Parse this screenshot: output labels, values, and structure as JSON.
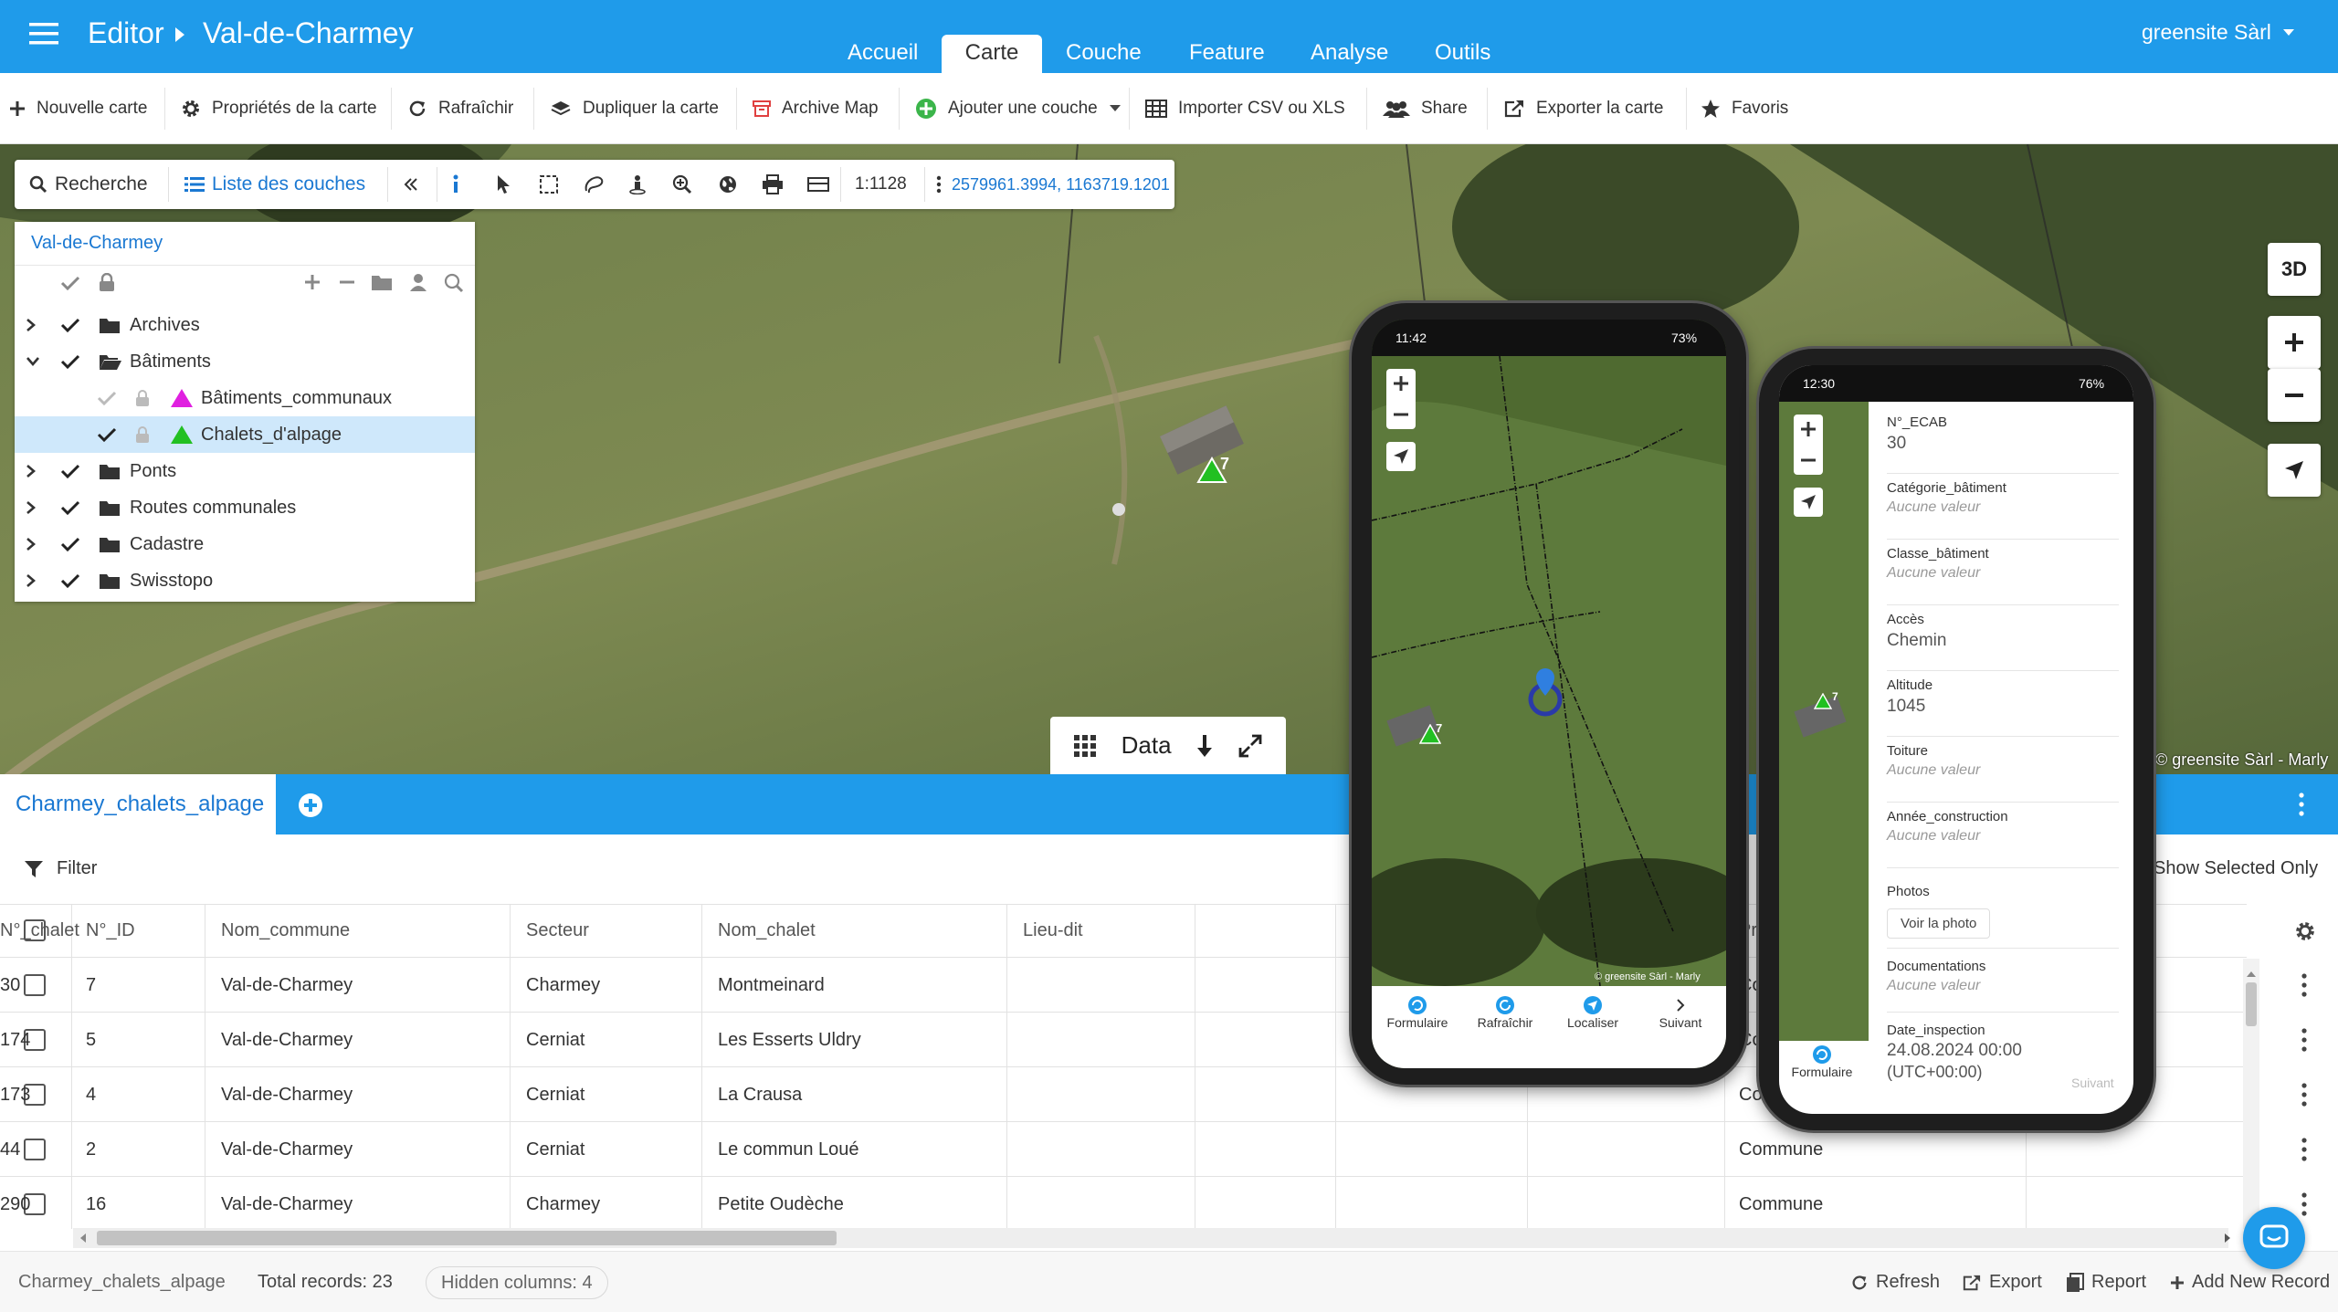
{
  "header": {
    "app": "Editor",
    "map_name": "Val-de-Charmey",
    "user": "greensite Sàrl",
    "tabs": [
      "Accueil",
      "Carte",
      "Couche",
      "Feature",
      "Analyse",
      "Outils"
    ],
    "active_tab": "Carte"
  },
  "toolbar": {
    "new_map": "Nouvelle carte",
    "map_props": "Propriétés de la carte",
    "refresh": "Rafraîchir",
    "duplicate": "Dupliquer la carte",
    "archive": "Archive Map",
    "add_layer": "Ajouter une couche",
    "import": "Importer CSV ou XLS",
    "share": "Share",
    "export": "Exporter la carte",
    "favorites": "Favoris"
  },
  "maptools": {
    "search": "Recherche",
    "layer_list": "Liste des couches",
    "scale": "1:1128",
    "coords": "2579961.3994, 1163719.1201"
  },
  "layers": {
    "root": "Val-de-Charmey",
    "items": [
      {
        "label": "Archives",
        "type": "folder",
        "expanded": false
      },
      {
        "label": "Bâtiments",
        "type": "folder",
        "expanded": true
      },
      {
        "label": "Bâtiments_communaux",
        "type": "layer",
        "color": "#e020e0"
      },
      {
        "label": "Chalets_d'alpage",
        "type": "layer",
        "color": "#22c022"
      },
      {
        "label": "Ponts",
        "type": "folder",
        "expanded": false
      },
      {
        "label": "Routes communales",
        "type": "folder",
        "expanded": false
      },
      {
        "label": "Cadastre",
        "type": "folder",
        "expanded": false
      },
      {
        "label": "Swisstopo",
        "type": "folder",
        "expanded": false
      }
    ]
  },
  "map": {
    "btn_3d": "3D",
    "copyright": "© greensite Sàrl - Marly",
    "marker_label": "7",
    "data_label": "Data"
  },
  "table": {
    "tab_name": "Charmey_chalets_alpage",
    "filter": "Filter",
    "show_selected": "Show Selected Only",
    "columns": [
      "N°_ID",
      "Nom_commune",
      "Secteur",
      "Nom_chalet",
      "Lieu-dit",
      "N°_chalet"
    ],
    "partial_col": "Pr",
    "rows": [
      {
        "id": "7",
        "commune": "Val-de-Charmey",
        "secteur": "Charmey",
        "chalet": "Montmeinard",
        "lieu": "",
        "num": "30",
        "prop": "Co"
      },
      {
        "id": "5",
        "commune": "Val-de-Charmey",
        "secteur": "Cerniat",
        "chalet": "Les Esserts Uldry",
        "lieu": "",
        "num": "174",
        "prop": "Co"
      },
      {
        "id": "4",
        "commune": "Val-de-Charmey",
        "secteur": "Cerniat",
        "chalet": "La Crausa",
        "lieu": "",
        "num": "173",
        "prop": "Co"
      },
      {
        "id": "2",
        "commune": "Val-de-Charmey",
        "secteur": "Cerniat",
        "chalet": "Le commun Loué",
        "lieu": "",
        "num": "44",
        "prop": "Commune"
      },
      {
        "id": "16",
        "commune": "Val-de-Charmey",
        "secteur": "Charmey",
        "chalet": "Petite Oudèche",
        "lieu": "",
        "num": "290",
        "prop": "Commune"
      }
    ]
  },
  "footer": {
    "layer": "Charmey_chalets_alpage",
    "total": "Total records: 23",
    "hidden": "Hidden columns: 4",
    "refresh": "Refresh",
    "export": "Export",
    "report": "Report",
    "add": "Add New Record"
  },
  "phone1": {
    "time": "11:42",
    "battery": "73%",
    "marker": "7",
    "copyright": "© greensite Sàrl - Marly",
    "nav": [
      "Formulaire",
      "Rafraîchir",
      "Localiser",
      "Suivant"
    ]
  },
  "phone2": {
    "time": "12:30",
    "battery": "76%",
    "marker": "7",
    "fields": [
      {
        "label": "N°_ECAB",
        "value": "30",
        "empty": false
      },
      {
        "label": "Catégorie_bâtiment",
        "value": "Aucune valeur",
        "empty": true
      },
      {
        "label": "Classe_bâtiment",
        "value": "Aucune valeur",
        "empty": true
      },
      {
        "label": "Accès",
        "value": "Chemin",
        "empty": false
      },
      {
        "label": "Altitude",
        "value": "1045",
        "empty": false
      },
      {
        "label": "Toiture",
        "value": "Aucune valeur",
        "empty": true
      },
      {
        "label": "Année_construction",
        "value": "Aucune valeur",
        "empty": true
      }
    ],
    "photos_label": "Photos",
    "photo_btn": "Voir la photo",
    "docs_label": "Documentations",
    "docs_value": "Aucune valeur",
    "date_label": "Date_inspection",
    "date_value": "24.08.2024 00:00",
    "date_tz": "(UTC+00:00)",
    "nav_form": "Formulaire",
    "nav_next": "Suivant"
  }
}
